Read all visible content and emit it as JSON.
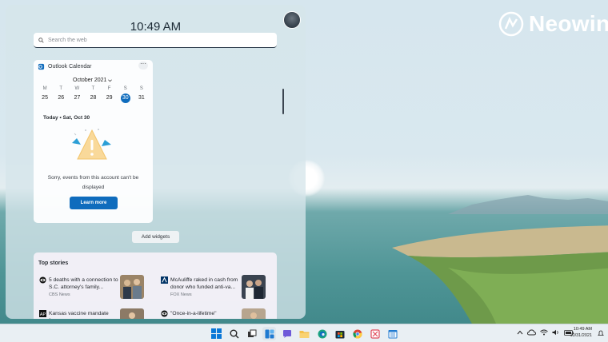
{
  "widgets_panel": {
    "time": "10:49 AM",
    "search_placeholder": "Search the web"
  },
  "calendar_widget": {
    "title": "Outlook Calendar",
    "menu_glyph": "···",
    "month": "October 2021",
    "weekdays": [
      "M",
      "T",
      "W",
      "T",
      "F",
      "S",
      "S"
    ],
    "days": [
      "25",
      "26",
      "27",
      "28",
      "29",
      "30",
      "31"
    ],
    "selected_day": "30",
    "today_line": "Today • Sat, Oct 30",
    "message": "Sorry, events from this account can't be displayed",
    "learn_more_label": "Learn more"
  },
  "add_widgets_label": "Add widgets",
  "top_stories": {
    "title": "Top stories",
    "items": [
      {
        "headline": "5 deaths with a connection to S.C. attorney's family...",
        "source": "CBS News"
      },
      {
        "headline": "McAuliffe raked in cash from donor who funded anti-va...",
        "source": "FOX News"
      },
      {
        "headline": "Kansas vaccine mandate foes",
        "source": ""
      },
      {
        "headline": "\"Once-in-a-lifetime\"",
        "source": ""
      }
    ]
  },
  "watermark": "Neowin",
  "taskbar": {
    "apps": [
      "start-icon",
      "search-icon",
      "task-view-icon",
      "widgets-icon",
      "chat-icon",
      "file-explorer-icon",
      "edge-icon",
      "store-icon",
      "chrome-icon",
      "snipping-tool-icon",
      "calendar-app-icon"
    ],
    "clock_time": "10:49 AM",
    "clock_date": "10/31/2021"
  },
  "colors": {
    "accent": "#0f6cbd",
    "panel": "#d6e5eb"
  }
}
